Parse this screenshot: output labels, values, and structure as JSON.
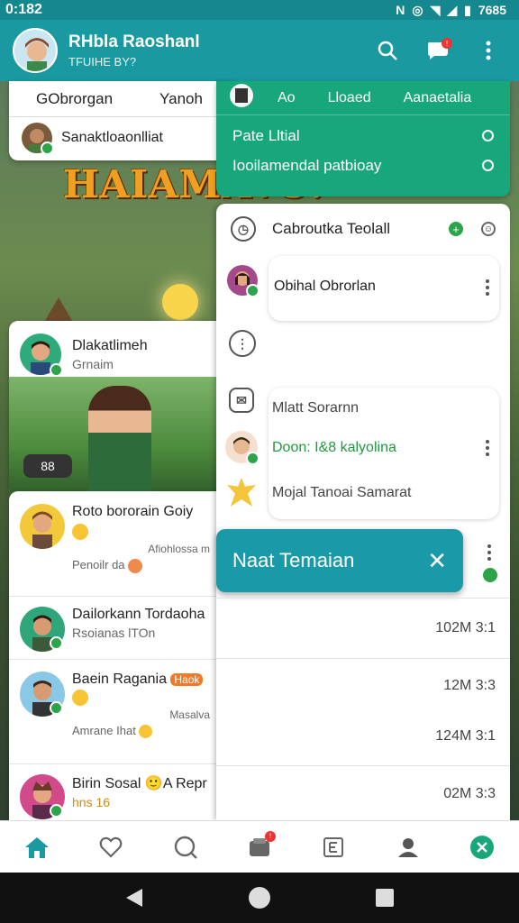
{
  "status": {
    "time": "0:182",
    "battery": "7685"
  },
  "app_bar": {
    "title": "RHbla Raoshanl",
    "subtitle": "TFUIHE BY?"
  },
  "left_top": {
    "tabs": [
      "GObrorgan",
      "Yanoh"
    ],
    "user_name": "Sanaktloaonlliat"
  },
  "banner_text": "HAIAMAVS!",
  "feature": {
    "title": "Dlakatlimeh",
    "subtitle": "Grnaim",
    "pill": "88"
  },
  "chat_list": [
    {
      "name": "Roto bororain Goiy",
      "line2": "Afiohlossa m",
      "line3": "Penoilr da"
    },
    {
      "name": "Dailorkann Tordaoha",
      "line2": "Rsoianas lTOn"
    },
    {
      "name": "Baein Ragania",
      "badge": "Haok",
      "line2": "Masalva",
      "line3": "Amrane Ihat"
    },
    {
      "name": "Birin Sosal 🙂A Repr",
      "line2": "hns 16"
    }
  ],
  "green_panel": {
    "tabs": [
      "Ao",
      "Lloaed",
      "Aanaetalia"
    ],
    "line1": "Pate   Lltial",
    "line2": "Iooilamendal patbioay"
  },
  "right_panel": {
    "row1": "Cabroutka Teolall",
    "bubble1": "Obihal Obrorlan",
    "group_row1": "Mlatt Sorarnn",
    "group_row2": "Doon: I&8 kalyolina",
    "group_row3": "Mojal Tanoai Samarat"
  },
  "toast": {
    "text": "Naat Temaian"
  },
  "times": [
    "102M 3:1",
    "12M 3:3",
    "124M 3:1",
    "02M 3:3"
  ],
  "colors": {
    "teal": "#1a9aa0",
    "green": "#17a77a",
    "online": "#2ca44a"
  }
}
